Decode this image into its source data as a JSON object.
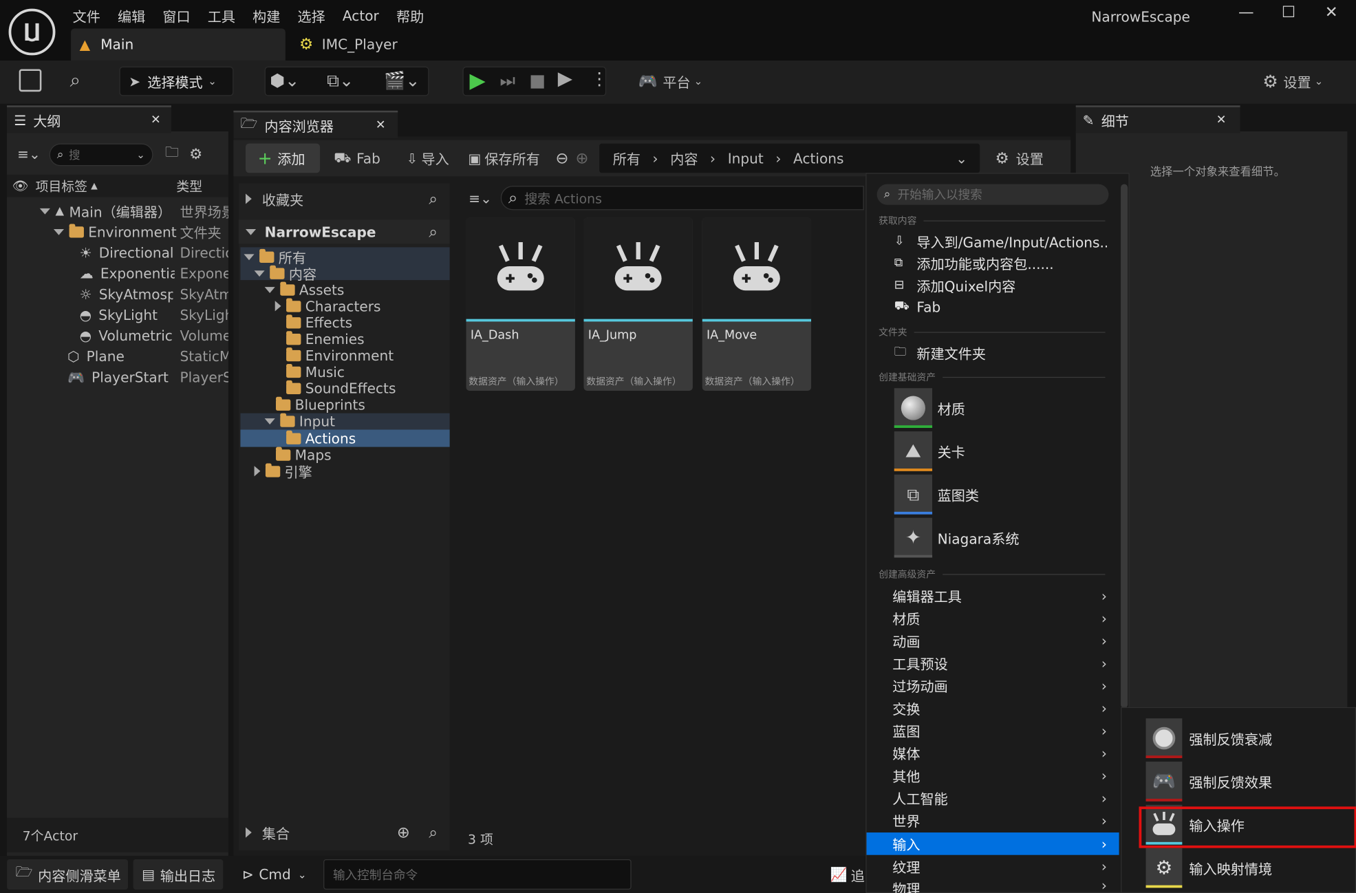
{
  "title_bar": {
    "app_title": "NarrowEscape",
    "menu": [
      "文件",
      "编辑",
      "窗口",
      "工具",
      "构建",
      "选择",
      "Actor",
      "帮助"
    ],
    "tabs": [
      {
        "label": "Main"
      },
      {
        "label": "IMC_Player"
      }
    ]
  },
  "toolbar": {
    "select_mode": "选择模式",
    "platform": "平台",
    "settings": "设置"
  },
  "outliner": {
    "tab": "大纲",
    "search_placeholder": "搜",
    "col_label": "项目标签",
    "col_type": "类型",
    "rows": [
      {
        "label": "Main（编辑器）",
        "type": "世界场景"
      },
      {
        "label": "Environment",
        "type": "文件夹"
      },
      {
        "label": "DirectionalL",
        "type": "Directio"
      },
      {
        "label": "Exponential",
        "type": "Exponen"
      },
      {
        "label": "SkyAtmosp",
        "type": "SkyAtm"
      },
      {
        "label": "SkyLight",
        "type": "SkyLigh"
      },
      {
        "label": "VolumetricC",
        "type": "Volume"
      },
      {
        "label": "Plane",
        "type": "StaticM"
      },
      {
        "label": "PlayerStart",
        "type": "PlayerS"
      }
    ],
    "footer": "7个Actor"
  },
  "content_browser": {
    "tab": "内容浏览器",
    "add": "添加",
    "fab": "Fab",
    "import": "导入",
    "save_all": "保存所有",
    "breadcrumb": [
      "所有",
      "内容",
      "Input",
      "Actions"
    ],
    "settings": "设置",
    "favorites": "收藏夹",
    "project": "NarrowEscape",
    "tree": [
      {
        "label": "所有",
        "depth": 0
      },
      {
        "label": "内容",
        "depth": 1
      },
      {
        "label": "Assets",
        "depth": 2
      },
      {
        "label": "Characters",
        "depth": 3
      },
      {
        "label": "Effects",
        "depth": 3
      },
      {
        "label": "Enemies",
        "depth": 3
      },
      {
        "label": "Environment",
        "depth": 3
      },
      {
        "label": "Music",
        "depth": 3
      },
      {
        "label": "SoundEffects",
        "depth": 3
      },
      {
        "label": "Blueprints",
        "depth": 2
      },
      {
        "label": "Input",
        "depth": 2
      },
      {
        "label": "Actions",
        "depth": 3
      },
      {
        "label": "Maps",
        "depth": 2
      },
      {
        "label": "引擎",
        "depth": 1
      }
    ],
    "collections": "集合",
    "search_placeholder": "搜索 Actions",
    "assets": [
      {
        "name": "IA_Dash",
        "type": "数据资产（输入操作）"
      },
      {
        "name": "IA_Jump",
        "type": "数据资产（输入操作）"
      },
      {
        "name": "IA_Move",
        "type": "数据资产（输入操作）"
      }
    ],
    "item_count": "3 项"
  },
  "details": {
    "tab": "细节",
    "empty_text": "选择一个对象来查看细节。"
  },
  "context_menu": {
    "search_placeholder": "开始输入以搜索",
    "section_get": "获取内容",
    "get_items": [
      "导入到/Game/Input/Actions......",
      "添加功能或内容包......",
      "添加Quixel内容",
      "Fab"
    ],
    "section_folder": "文件夹",
    "new_folder": "新建文件夹",
    "section_basic": "创建基础资产",
    "basic": [
      {
        "label": "材质",
        "color": "#2fae3a"
      },
      {
        "label": "关卡",
        "color": "#e08a1e"
      },
      {
        "label": "蓝图类",
        "color": "#3a7ee0"
      },
      {
        "label": "Niagara系统",
        "color": "#555555"
      }
    ],
    "section_advanced": "创建高级资产",
    "advanced": [
      "编辑器工具",
      "材质",
      "动画",
      "工具预设",
      "过场动画",
      "交换",
      "蓝图",
      "媒体",
      "其他",
      "人工智能",
      "世界",
      "输入",
      "纹理",
      "物理"
    ],
    "highlighted": "输入"
  },
  "submenu": {
    "items": [
      {
        "label": "强制反馈衰减",
        "color": "#b01818"
      },
      {
        "label": "强制反馈效果",
        "color": "#b01818"
      },
      {
        "label": "输入操作",
        "color": "#56c7dc"
      },
      {
        "label": "输入映射情境",
        "color": "#e8d84a"
      }
    ]
  },
  "bottom": {
    "drawer": "内容侧滑菜单",
    "output_log": "输出日志",
    "cmd": "Cmd",
    "cmd_placeholder": "输入控制台命令",
    "trace": "追"
  },
  "colors": {
    "accent": "#0070e0",
    "play": "#4cc94c",
    "highlight_box": "#e01010",
    "selection": "#3a5a7e"
  }
}
